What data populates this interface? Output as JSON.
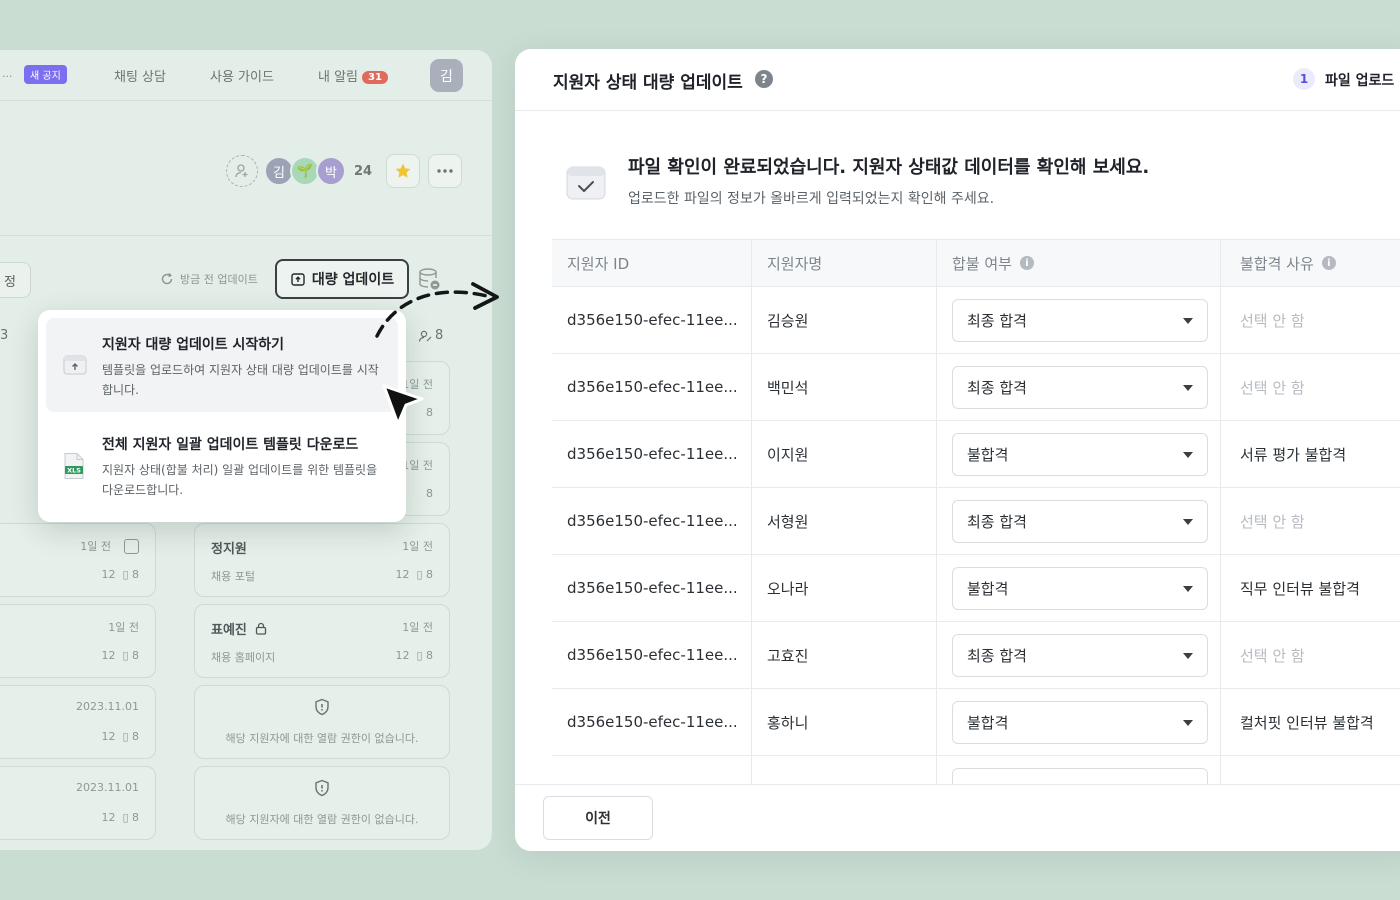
{
  "background_app": {
    "nav": {
      "truncated": "...",
      "new_badge": "새 공지",
      "chat": "채팅 상담",
      "guide": "사용 가이드",
      "alerts": "내 알림",
      "alerts_count": "31",
      "avatar_initial": "김"
    },
    "collaborators": {
      "avatars": [
        "김",
        "🌱",
        "박"
      ],
      "count": "24"
    },
    "toolbar": {
      "edit_fragment": "정",
      "refresh": "방금 전 업데이트",
      "bulk_update": "대량 업데이트"
    },
    "column_head_left": "3",
    "column_head_right": "8",
    "cards": [
      {
        "name": "정지원",
        "source": "채용 포털",
        "time": "1일 전",
        "comments": "12",
        "docs": "8"
      },
      {
        "name": "표예진",
        "source": "채용 홈페이지",
        "time": "1일 전",
        "comments": "12",
        "docs": "8"
      }
    ],
    "left_cards": [
      {
        "time": "1일 전",
        "comments": "12",
        "docs": "8"
      },
      {
        "time": "1일 전",
        "comments": "12",
        "docs": "8"
      },
      {
        "time": "2023.11.01",
        "comments": "12",
        "docs": "8"
      },
      {
        "time": "2023.11.01",
        "comments": "12",
        "docs": "8"
      }
    ],
    "partial_cards": [
      {
        "time": "1일 전",
        "docs": "8"
      },
      {
        "time": "1일 전",
        "docs": "8"
      }
    ],
    "no_permission": "해당 지원자에 대한 열람 권한이 없습니다."
  },
  "menu": {
    "items": [
      {
        "title": "지원자 대량 업데이트 시작하기",
        "desc": "템플릿을 업로드하여 지원자 상태 대량 업데이트를 시작합니다.",
        "icon": "upload-box-icon"
      },
      {
        "title": "전체 지원자 일괄 업데이트 템플릿 다운로드",
        "desc": "지원자 상태(합불 처리) 일괄 업데이트를 위한 템플릿을 다운로드합니다.",
        "icon": "xls-file-icon",
        "file_label": "XLS"
      }
    ]
  },
  "modal": {
    "title": "지원자 상태 대량 업데이트",
    "step_number": "1",
    "step_label": "파일 업로드",
    "confirm_title": "파일 확인이 완료되었습니다. 지원자 상태값 데이터를 확인해 보세요.",
    "confirm_sub": "업로드한 파일의 정보가 올바르게 입력되었는지 확인해 주세요.",
    "table": {
      "headers": [
        "지원자 ID",
        "지원자명",
        "합불 여부",
        "불합격 사유"
      ],
      "rows": [
        {
          "id": "d356e150-efec-11ee...",
          "name": "김승원",
          "status": "최종 합격",
          "reason": "선택 안 함",
          "reason_muted": true
        },
        {
          "id": "d356e150-efec-11ee...",
          "name": "백민석",
          "status": "최종 합격",
          "reason": "선택 안 함",
          "reason_muted": true
        },
        {
          "id": "d356e150-efec-11ee...",
          "name": "이지원",
          "status": "불합격",
          "reason": "서류 평가 불합격",
          "reason_muted": false
        },
        {
          "id": "d356e150-efec-11ee...",
          "name": "서형원",
          "status": "최종 합격",
          "reason": "선택 안 함",
          "reason_muted": true
        },
        {
          "id": "d356e150-efec-11ee...",
          "name": "오나라",
          "status": "불합격",
          "reason": "직무 인터뷰 불합격",
          "reason_muted": false
        },
        {
          "id": "d356e150-efec-11ee...",
          "name": "고효진",
          "status": "최종 합격",
          "reason": "선택 안 함",
          "reason_muted": true
        },
        {
          "id": "d356e150-efec-11ee...",
          "name": "홍하니",
          "status": "불합격",
          "reason": "컬처핏 인터뷰 불합격",
          "reason_muted": false
        }
      ]
    },
    "footer": {
      "prev": "이전"
    }
  },
  "colors": {
    "page_bg": "#c9ddd3",
    "accent": "#5a4fd8",
    "alert": "#e06a5c",
    "new_badge": "#7b6ff0"
  }
}
